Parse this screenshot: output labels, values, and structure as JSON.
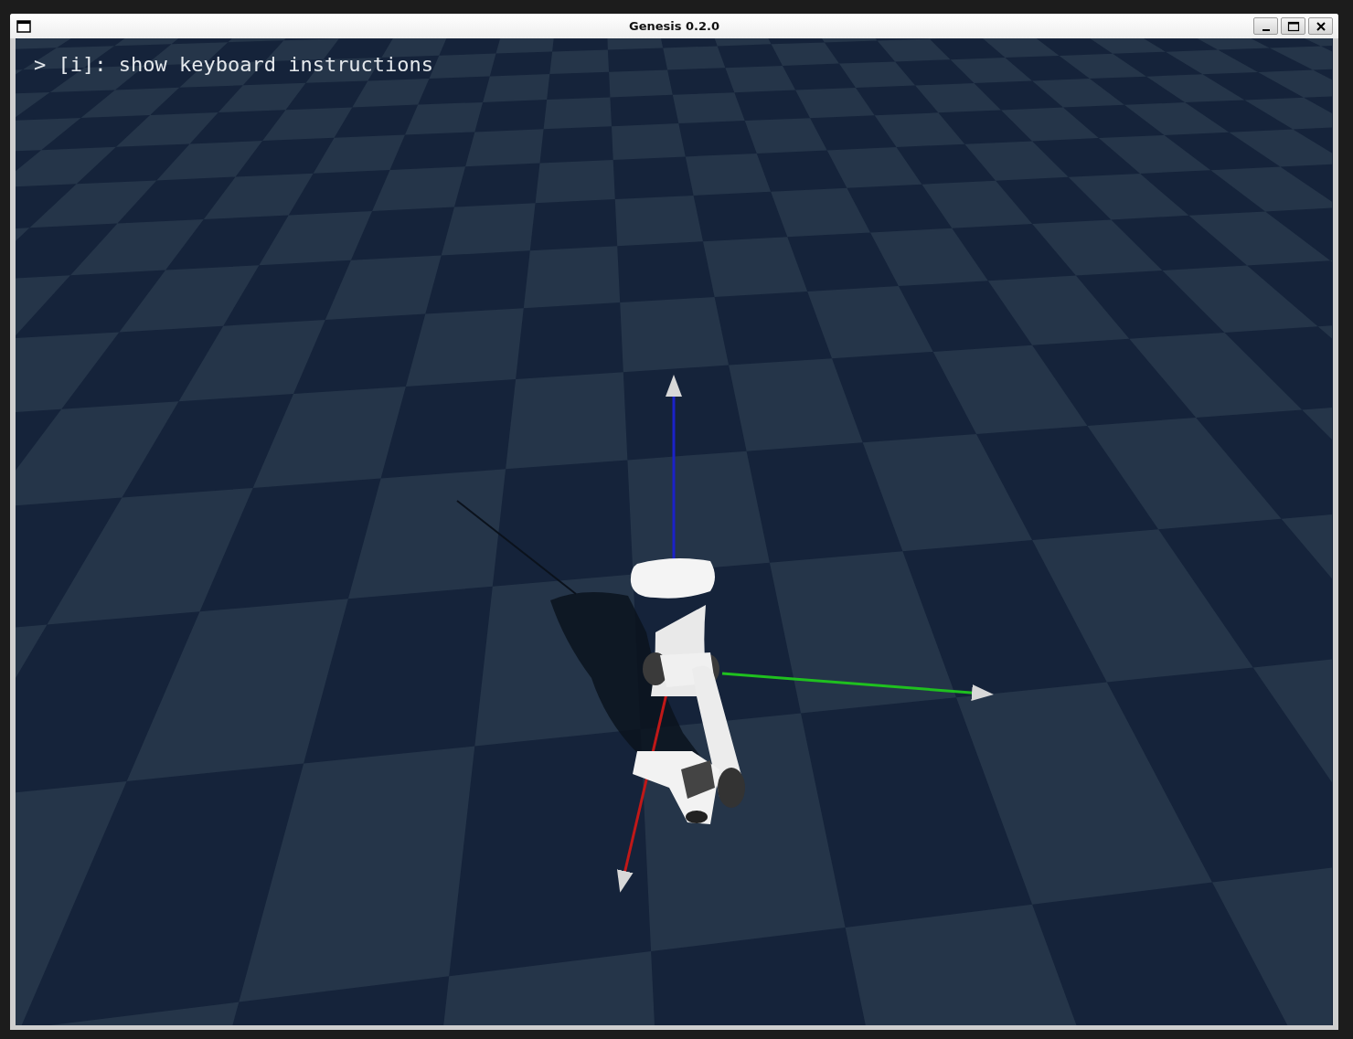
{
  "window": {
    "title": "Genesis 0.2.0",
    "controls": [
      {
        "kind": "minimize"
      },
      {
        "kind": "maximize"
      },
      {
        "kind": "close"
      }
    ]
  },
  "viewport": {
    "overlay_text": "> [i]: show keyboard instructions"
  }
}
